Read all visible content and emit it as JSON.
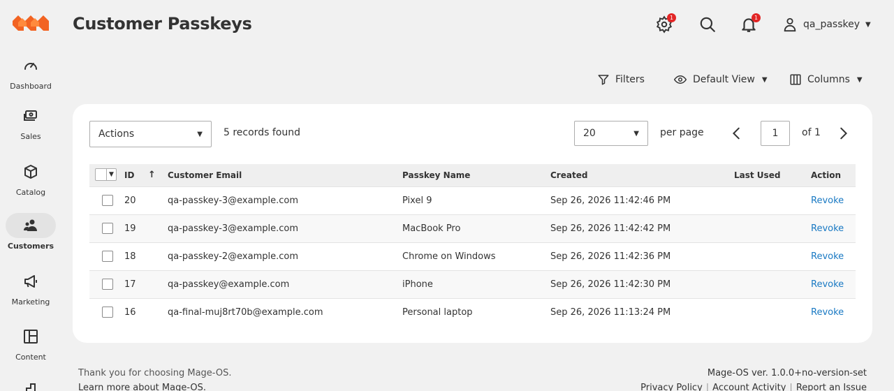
{
  "sidebar": {
    "items": [
      {
        "label": "Dashboard",
        "icon": "gauge-icon"
      },
      {
        "label": "Sales",
        "icon": "cash-icon"
      },
      {
        "label": "Catalog",
        "icon": "box-icon"
      },
      {
        "label": "Customers",
        "icon": "users-icon",
        "active": true
      },
      {
        "label": "Marketing",
        "icon": "megaphone-icon"
      },
      {
        "label": "Content",
        "icon": "layout-icon"
      }
    ]
  },
  "header": {
    "title": "Customer Passkeys",
    "system_messages_count": "1",
    "notifications_count": "1",
    "username": "qa_passkey"
  },
  "toolbar": {
    "filters_label": "Filters",
    "view_label": "Default View",
    "columns_label": "Columns"
  },
  "grid": {
    "actions_label": "Actions",
    "records_found": "5 records found",
    "per_page_value": "20",
    "per_page_label": "per page",
    "current_page": "1",
    "page_of": "of 1",
    "columns": {
      "id": "ID",
      "email": "Customer Email",
      "passkey_name": "Passkey Name",
      "created": "Created",
      "last_used": "Last Used",
      "action": "Action"
    },
    "rows": [
      {
        "id": "20",
        "email": "qa-passkey-3@example.com",
        "passkey_name": "Pixel 9",
        "created": "Sep 26, 2026 11:42:46 PM",
        "last_used": "",
        "action": "Revoke"
      },
      {
        "id": "19",
        "email": "qa-passkey-3@example.com",
        "passkey_name": "MacBook Pro",
        "created": "Sep 26, 2026 11:42:42 PM",
        "last_used": "",
        "action": "Revoke"
      },
      {
        "id": "18",
        "email": "qa-passkey-2@example.com",
        "passkey_name": "Chrome on Windows",
        "created": "Sep 26, 2026 11:42:36 PM",
        "last_used": "",
        "action": "Revoke"
      },
      {
        "id": "17",
        "email": "qa-passkey@example.com",
        "passkey_name": "iPhone",
        "created": "Sep 26, 2026 11:42:30 PM",
        "last_used": "",
        "action": "Revoke"
      },
      {
        "id": "16",
        "email": "qa-final-muj8rt70b@example.com",
        "passkey_name": "Personal laptop",
        "created": "Sep 26, 2026 11:13:24 PM",
        "last_used": "",
        "action": "Revoke"
      }
    ]
  },
  "footer": {
    "thanks": "Thank you for choosing Mage-OS.",
    "learn_more": "Learn more about Mage-OS.",
    "version": "Mage-OS ver. 1.0.0+no-version-set",
    "links": [
      "Privacy Policy",
      "Account Activity",
      "Report an Issue"
    ]
  },
  "colors": {
    "brand_orange": "#f26322",
    "link_blue": "#1979c3",
    "badge_red": "#e22626"
  }
}
